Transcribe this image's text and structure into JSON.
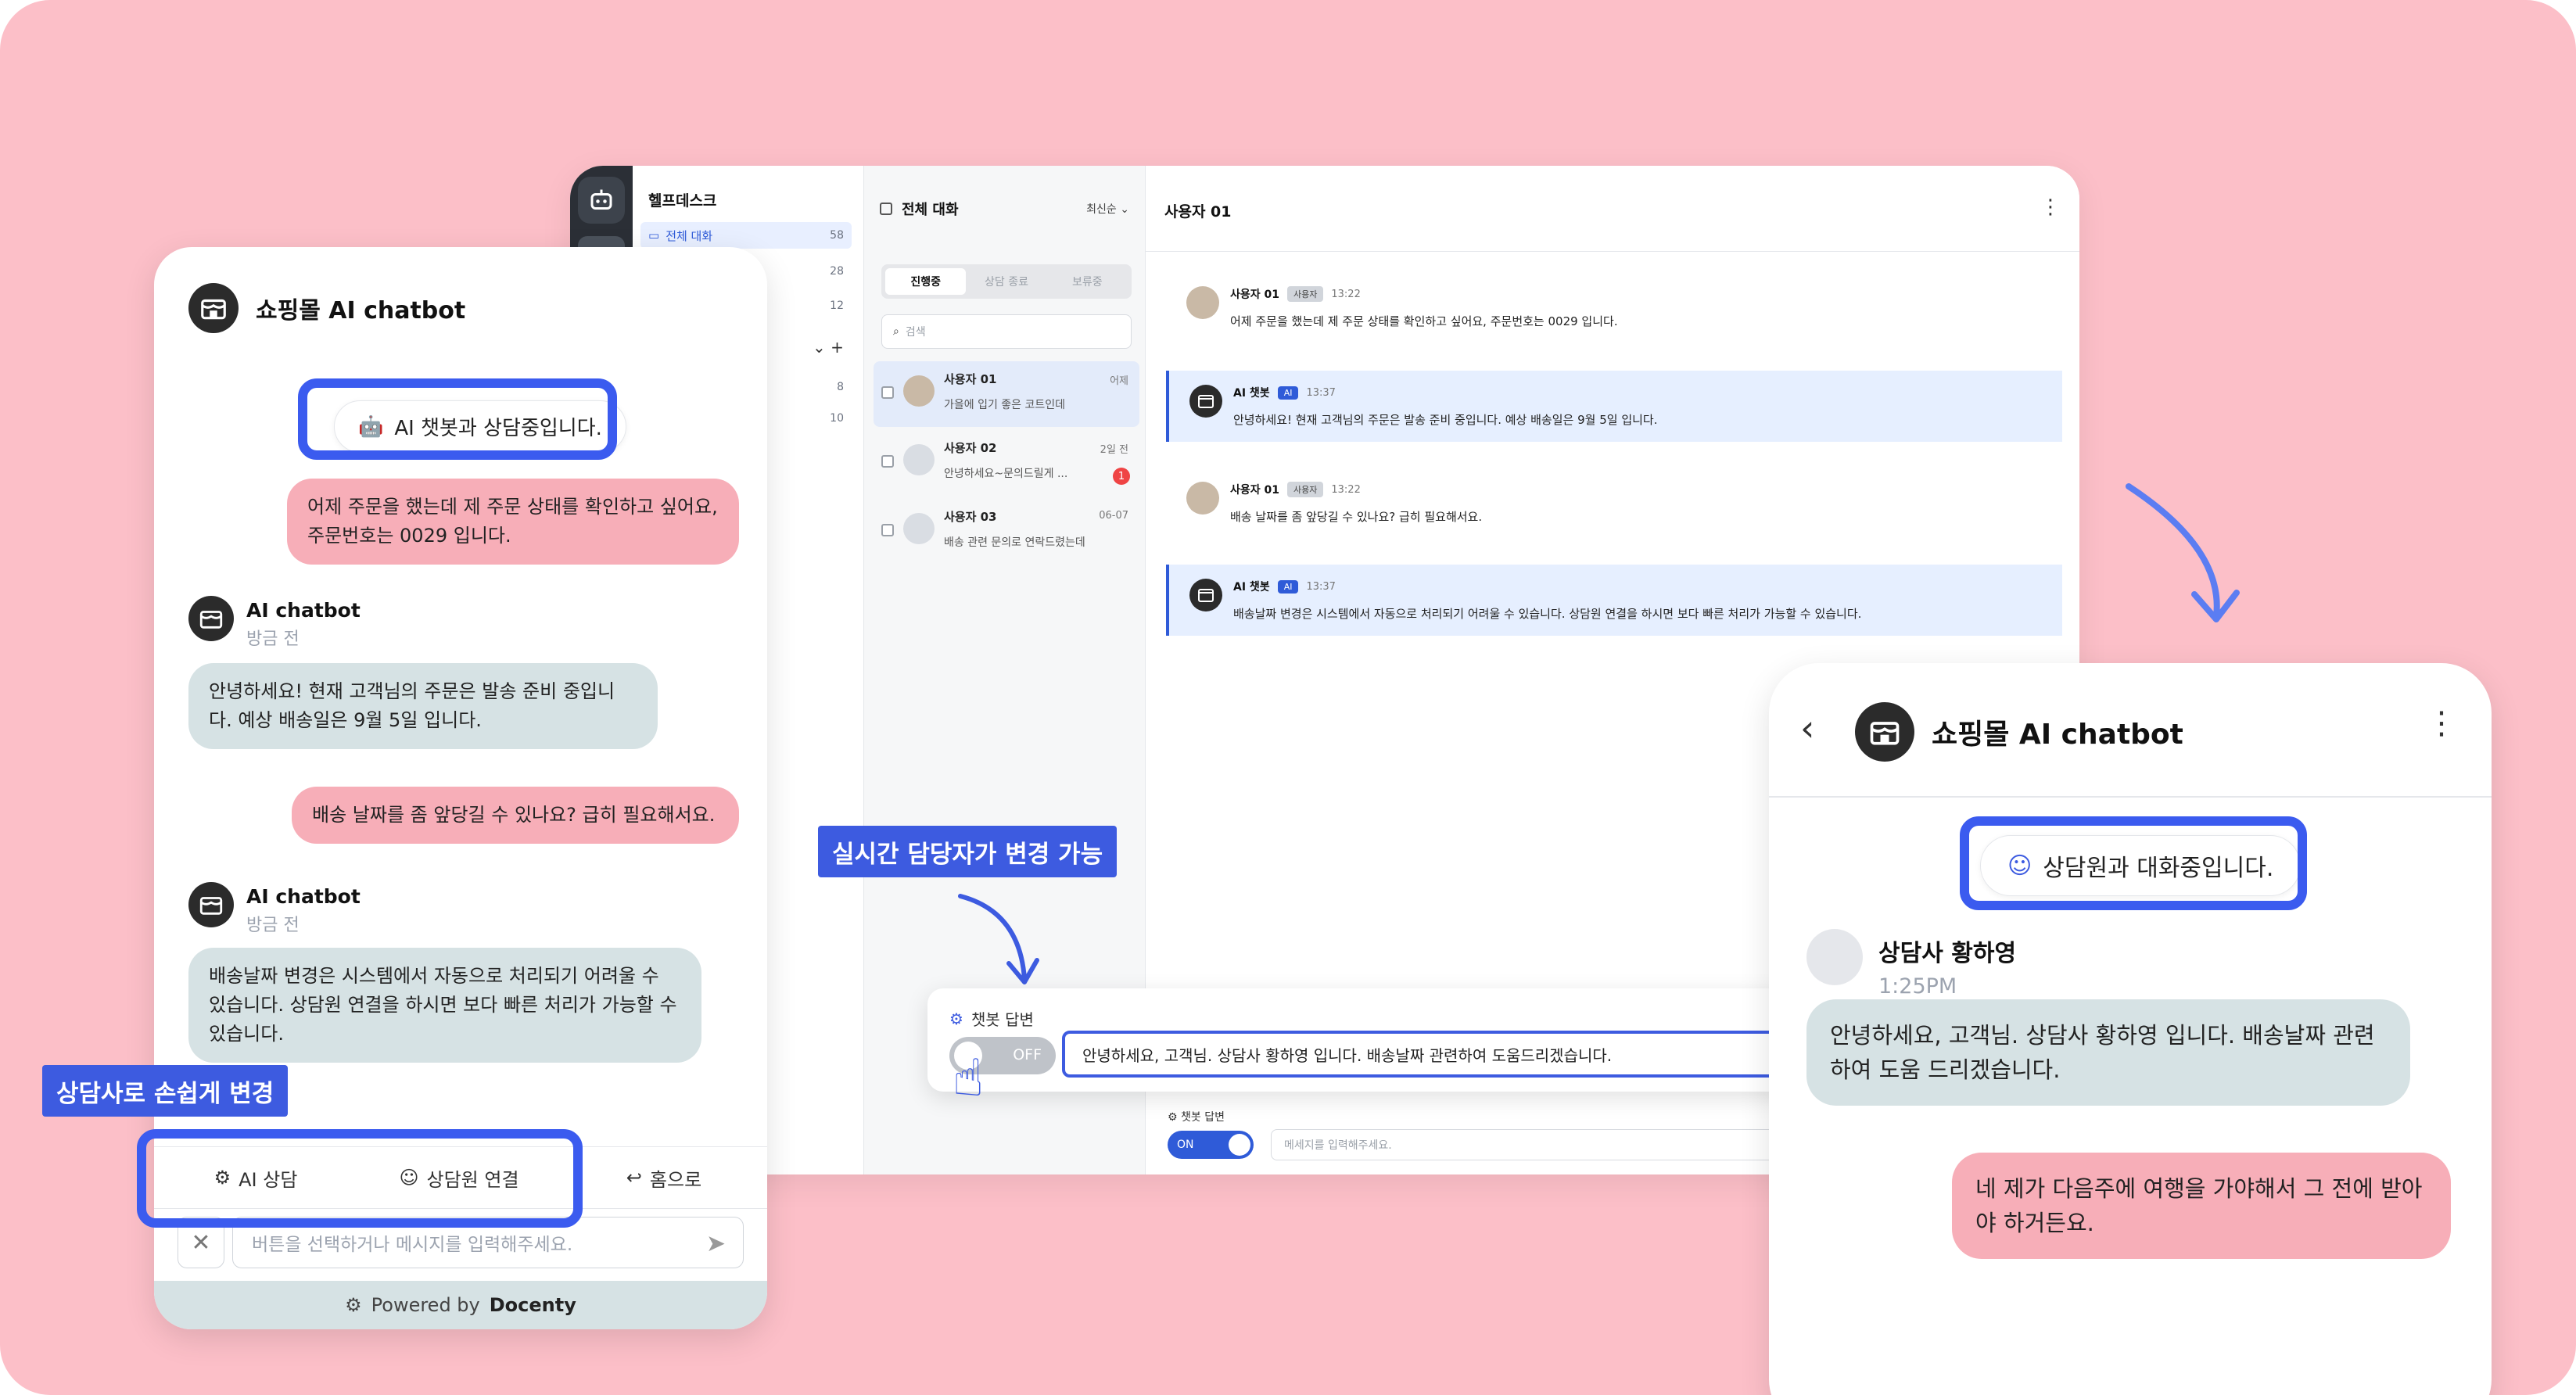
{
  "helpdesk": {
    "nav_title": "헬프데스크",
    "nav_items": [
      {
        "label": "전체 대화",
        "count": "58"
      },
      {
        "label": "",
        "count": "28"
      },
      {
        "label": "",
        "count": "12"
      },
      {
        "label": "",
        "count": "8"
      },
      {
        "label": "",
        "count": "10"
      }
    ],
    "list_header": "전체 대화",
    "sort_label": "최신순",
    "segments": [
      "진행중",
      "상담 종료",
      "보류중"
    ],
    "search_placeholder": "검색",
    "conversations": [
      {
        "name": "사용자 01",
        "time": "어제",
        "preview": "가을에 입기 좋은 코트인데"
      },
      {
        "name": "사용자 02",
        "time": "2일 전",
        "preview": "안녕하세요~문의드릴게 ...",
        "badge": "1"
      },
      {
        "name": "사용자 03",
        "time": "06-07",
        "preview": "배송 관련 문의로 연락드렸는데"
      }
    ],
    "main_title": "사용자 01",
    "messages": [
      {
        "sender": "사용자 01",
        "tag": "사용자",
        "time": "13:22",
        "text": "어제 주문을 했는데 제 주문 상태를 확인하고 싶어요, 주문번호는 0029 입니다."
      },
      {
        "sender": "AI 챗봇",
        "tag": "AI",
        "time": "13:37",
        "text": "안녕하세요! 현재 고객님의 주문은 발송 준비 중입니다. 예상 배송일은 9월 5일 입니다."
      },
      {
        "sender": "사용자 01",
        "tag": "사용자",
        "time": "13:22",
        "text": "배송 날짜를 좀 앞당길 수 있나요? 급히 필요해서요."
      },
      {
        "sender": "AI 챗봇",
        "tag": "AI",
        "time": "13:37",
        "text": "배송날짜 변경은 시스템에서 자동으로 처리되기 어려울 수 있습니다. 상담원 연결을 하시면 보다 빠른 처리가 가능할 수 있습니다."
      }
    ],
    "footer": {
      "label": "챗봇 답변",
      "toggle": "ON",
      "placeholder": "메세지를 입력해주세요."
    }
  },
  "widget": {
    "title": "쇼핑몰 AI chatbot",
    "status_pill": "AI 챗봇과 상담중입니다.",
    "bubbles": [
      {
        "type": "user",
        "text": "어제 주문을 했는데 제 주문 상태를 확인하고 싶어요, 주문번호는 0029 입니다."
      },
      {
        "type": "bot",
        "sender": "AI chatbot",
        "time": "방금 전",
        "text": "안녕하세요! 현재 고객님의 주문은 발송 준비 중입니다. 예상 배송일은 9월 5일 입니다."
      },
      {
        "type": "user",
        "text": "배송 날짜를 좀 앞당길 수 있나요? 급히 필요해서요."
      },
      {
        "type": "bot",
        "sender": "AI chatbot",
        "time": "방금 전",
        "text": "배송날짜 변경은 시스템에서 자동으로 처리되기 어려울 수 있습니다. 상담원 연결을 하시면 보다 빠른 처리가 가능할 수 있습니다."
      }
    ],
    "tabs": [
      "AI 상담",
      "상담원 연결",
      "홈으로"
    ],
    "input_placeholder": "버튼을 선택하거나 메시지를 입력해주세요.",
    "powered_prefix": "Powered by",
    "powered_brand": "Docenty"
  },
  "callouts": {
    "agent_switch": "상담사로 손쉽게 변경",
    "realtime_change": "실시간 담당자가 변경 가능"
  },
  "reply_bar": {
    "label": "챗봇 답변",
    "toggle": "OFF",
    "message": "안녕하세요, 고객님. 상담사 황하영 입니다. 배송날짜 관련하여 도움드리겠습니다."
  },
  "phone": {
    "title": "쇼핑몰 AI chatbot",
    "status_pill": "상담원과 대화중입니다.",
    "agent_name": "상담사 황하영",
    "agent_time": "1:25PM",
    "agent_message": "안녕하세요, 고객님. 상담사 황하영 입니다. 배송날짜 관련하여 도움 드리겠습니다.",
    "user_message": "네 제가 다음주에 여행을 가야해서 그 전에 받아야 하거든요."
  },
  "colors": {
    "background": "#fcbfc8",
    "accent": "#3d5be0",
    "user_bubble": "#f7aeb8",
    "bot_bubble": "#d6e2e4"
  }
}
